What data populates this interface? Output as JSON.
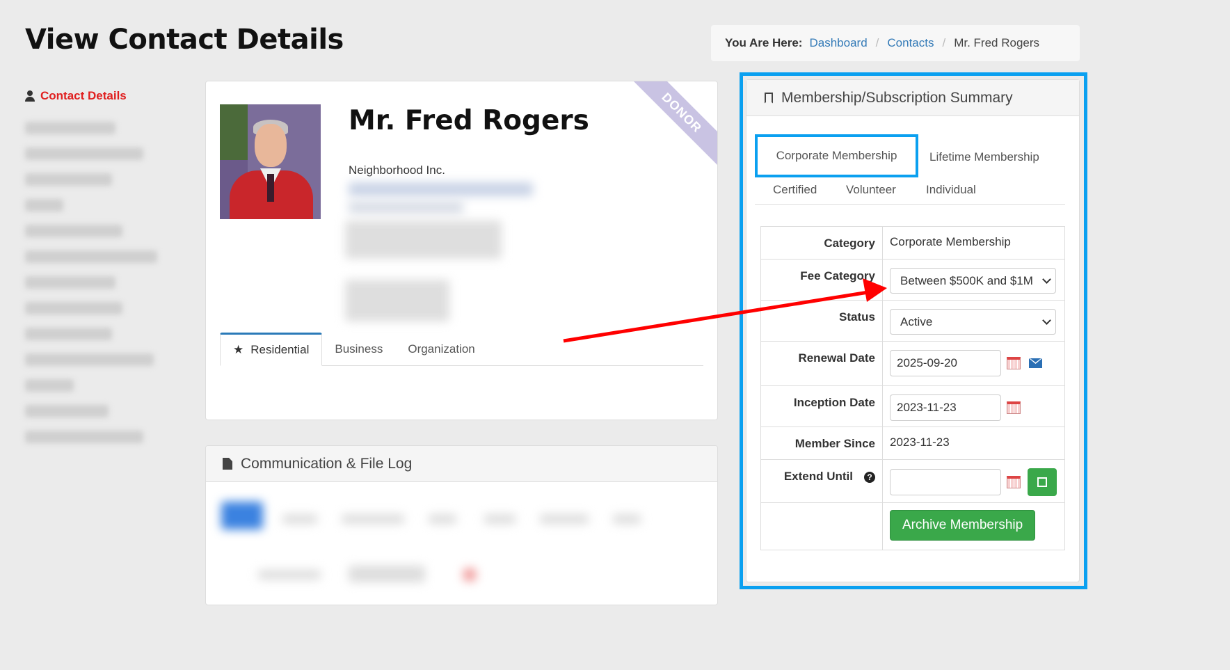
{
  "page": {
    "title": "View Contact Details"
  },
  "breadcrumb": {
    "label": "You Are Here:",
    "items": [
      "Dashboard",
      "Contacts"
    ],
    "current": "Mr. Fred Rogers"
  },
  "sidebar": {
    "active_label": "Contact Details"
  },
  "profile": {
    "name": "Mr. Fred Rogers",
    "organization": "Neighborhood Inc.",
    "ribbon": "DONOR",
    "tabs": [
      "Residential",
      "Business",
      "Organization"
    ]
  },
  "comm_log": {
    "title": "Communication & File Log"
  },
  "membership": {
    "title": "Membership/Subscription Summary",
    "tabs": [
      "Corporate Membership",
      "Lifetime Membership",
      "Certified",
      "Volunteer",
      "Individual"
    ],
    "fields": {
      "category_label": "Category",
      "category_value": "Corporate Membership",
      "fee_category_label": "Fee Category",
      "fee_category_value": "Between $500K and $1M",
      "status_label": "Status",
      "status_value": "Active",
      "renewal_label": "Renewal Date",
      "renewal_value": "2025-09-20",
      "inception_label": "Inception Date",
      "inception_value": "2023-11-23",
      "member_since_label": "Member Since",
      "member_since_value": "2023-11-23",
      "extend_label": "Extend Until",
      "extend_value": ""
    },
    "archive_label": "Archive Membership"
  },
  "colors": {
    "accent": "#0aa0f0",
    "link": "#337ab7",
    "active_nav": "#e02020",
    "button_green": "#3aa84a",
    "arrow": "#ff0000"
  }
}
